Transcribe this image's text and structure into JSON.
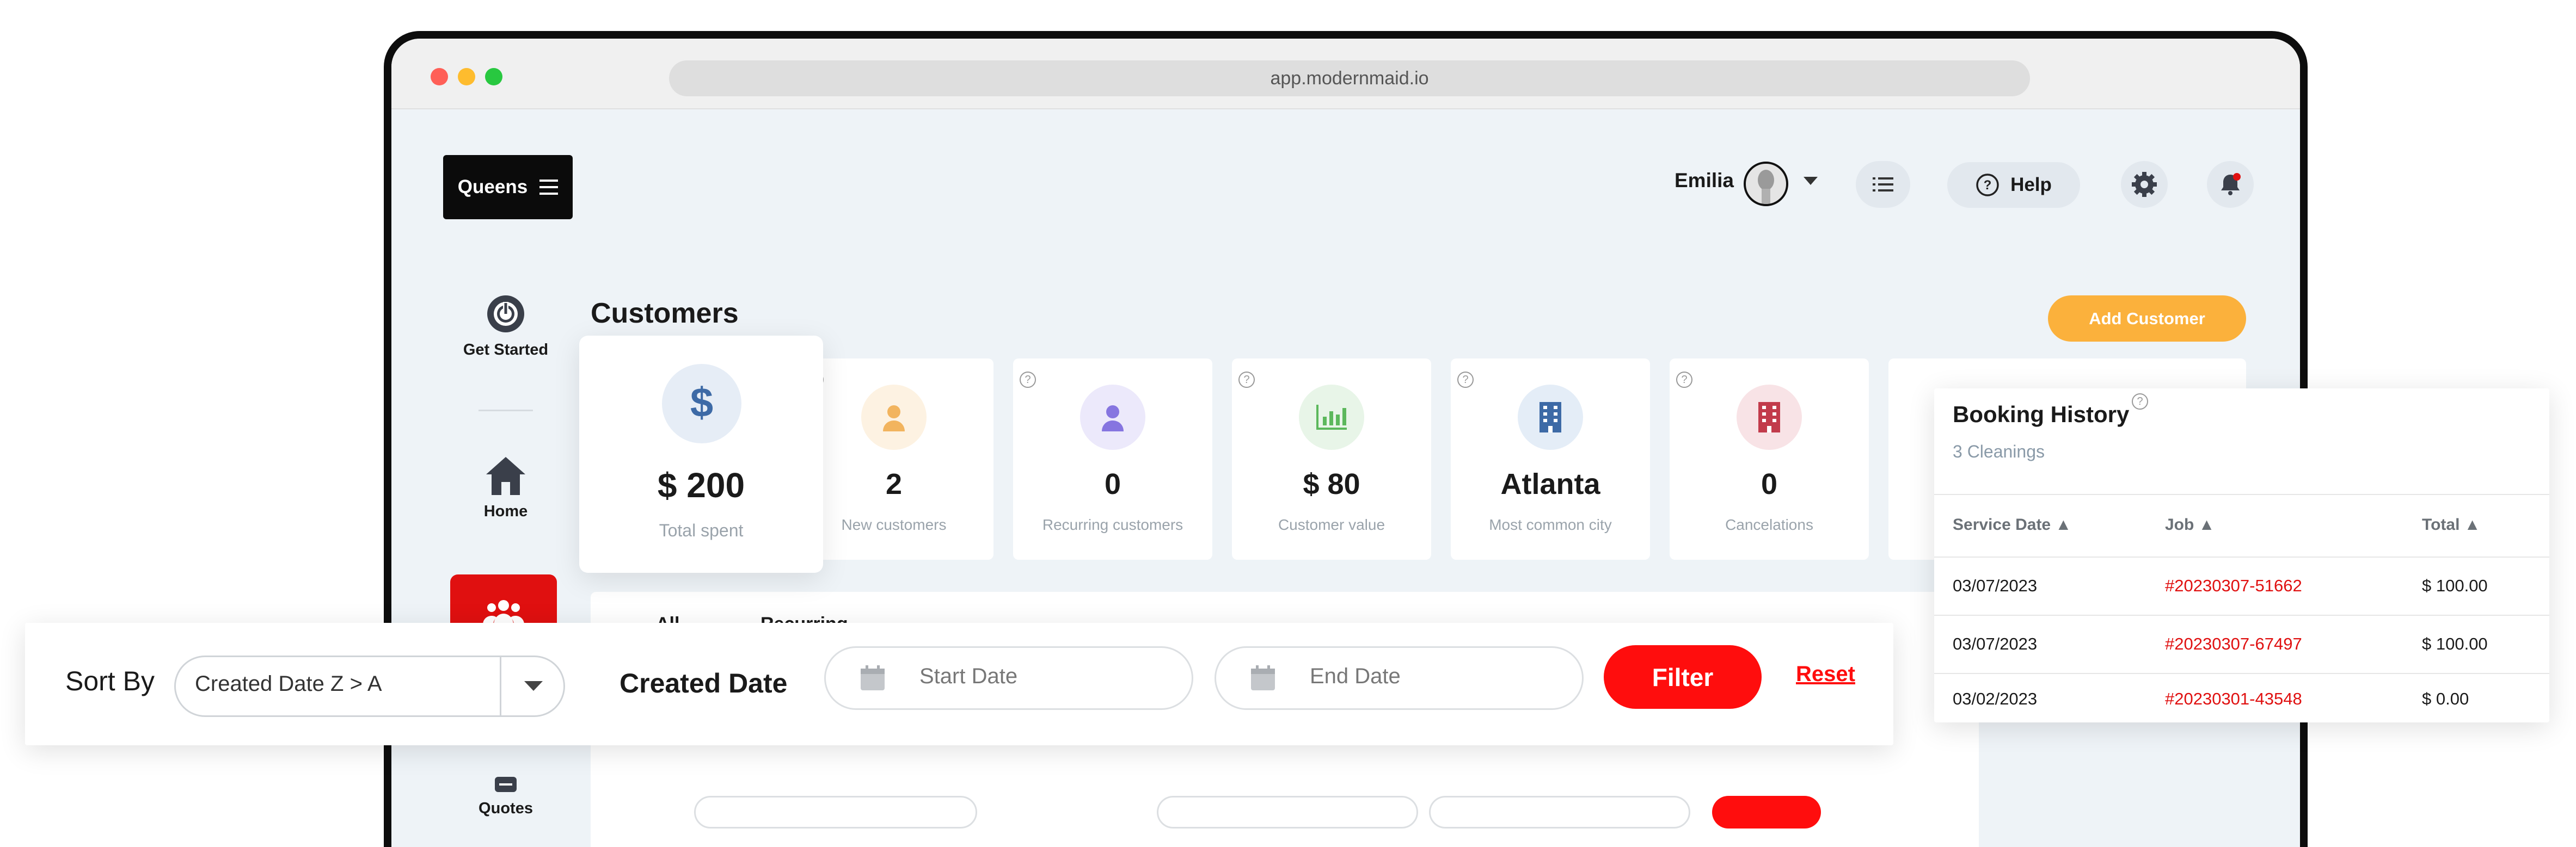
{
  "browser": {
    "url": "app.modernmaid.io",
    "dot_colors": [
      "#ff5f57",
      "#febc2e",
      "#28c840"
    ]
  },
  "header": {
    "workspace": "Queens",
    "user_name": "Emilia",
    "help_label": "Help",
    "icons": [
      "menu-icon",
      "list-icon",
      "help-circle-icon",
      "gear-icon",
      "bell-icon"
    ],
    "notification_dot_color": "#e01010"
  },
  "sidebar": {
    "items": [
      {
        "label": "Get Started",
        "icon": "power-icon"
      },
      {
        "label": "Home",
        "icon": "home-icon"
      },
      {
        "label": "",
        "icon": "people-icon"
      },
      {
        "label": "Quotes",
        "icon": "quotes-icon"
      }
    ],
    "active_color": "#e01010"
  },
  "main": {
    "title": "Customers",
    "add_button": "Add Customer",
    "accent": "#fbb13c",
    "stats": [
      {
        "value": "$ 200",
        "label": "Total spent",
        "icon": "dollar-icon"
      },
      {
        "value": "2",
        "label": "New customers",
        "icon": "user-icon"
      },
      {
        "value": "0",
        "label": "Recurring customers",
        "icon": "user-icon"
      },
      {
        "value": "$ 80",
        "label": "Customer value",
        "icon": "bar-chart-icon"
      },
      {
        "value": "Atlanta",
        "label": "Most common city",
        "icon": "building-icon"
      },
      {
        "value": "0",
        "label": "Cancelations",
        "icon": "building-icon"
      }
    ],
    "tabs": [
      "All",
      "Recurring"
    ]
  },
  "sort_bar": {
    "sort_label": "Sort By",
    "sort_value": "Created Date Z > A",
    "created_label": "Created Date",
    "start_placeholder": "Start Date",
    "end_placeholder": "End Date",
    "filter_label": "Filter",
    "reset_label": "Reset",
    "primary_color": "#ff0d0d"
  },
  "booking_history": {
    "title": "Booking History",
    "subtitle": "3 Cleanings",
    "columns": [
      "Service Date",
      "Job",
      "Total"
    ],
    "rows": [
      {
        "date": "03/07/2023",
        "job": "#20230307-51662",
        "total": "$ 100.00"
      },
      {
        "date": "03/07/2023",
        "job": "#20230307-67497",
        "total": "$ 100.00"
      },
      {
        "date": "03/02/2023",
        "job": "#20230301-43548",
        "total": "$ 0.00"
      }
    ]
  }
}
